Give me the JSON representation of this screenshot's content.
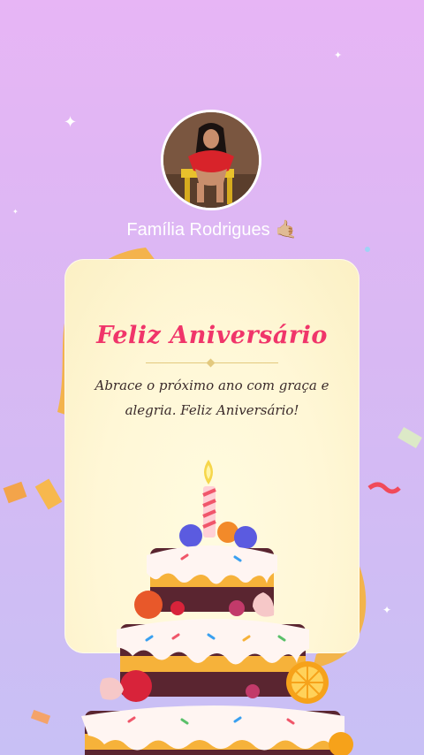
{
  "profile": {
    "name": "Família Rodrigues",
    "emoji": "🤙🏼"
  },
  "card": {
    "title": "Feliz Aniversário",
    "message": "Abrace o próximo ano com graça e alegria. Feliz Aniversário!"
  },
  "colors": {
    "title": "#f0356a",
    "background_top": "#e7b5f5",
    "background_bottom": "#c8c0f5",
    "card": "#fff7d6"
  },
  "icons": [
    "sparkle-icon",
    "birthday-cake-icon",
    "ribbon-icon",
    "confetti-icon"
  ]
}
